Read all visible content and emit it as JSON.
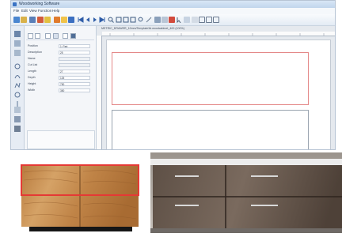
{
  "window": {
    "title": "Woodworking Software"
  },
  "menu": {
    "items": [
      "File",
      "Edit",
      "View",
      "Function",
      "Help"
    ]
  },
  "canvas": {
    "path": "METRIC_DRAWER_10mm/Template3d.woodcabinet_400 (100%)"
  },
  "properties": {
    "rows": [
      {
        "label": "Position",
        "value": "1: Part"
      },
      {
        "label": "Description",
        "value": "25"
      },
      {
        "label": "Name",
        "value": ""
      },
      {
        "label": "Cut List",
        "value": ""
      },
      {
        "label": "Length",
        "value": "27"
      },
      {
        "label": "Depth",
        "value": "125"
      },
      {
        "label": "Height",
        "value": "750"
      },
      {
        "label": "Width",
        "value": "350"
      }
    ]
  },
  "colors": {
    "highlight": "#e53935",
    "accent": "#3a73c4"
  },
  "photo": {
    "left_item": "wood-grain drawer chest",
    "right_item": "dark wood bathroom vanity"
  }
}
